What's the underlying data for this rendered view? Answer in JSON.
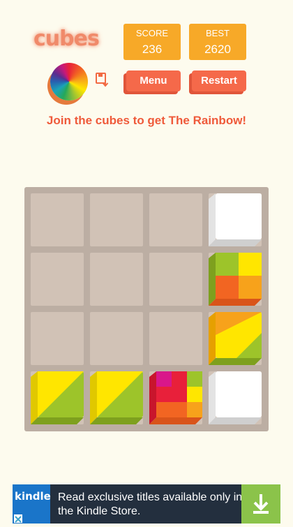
{
  "app": {
    "logo_text": "cubes"
  },
  "score": {
    "label": "SCORE",
    "value": "236"
  },
  "best": {
    "label": "BEST",
    "value": "2620"
  },
  "buttons": {
    "menu": "Menu",
    "restart": "Restart"
  },
  "tagline": "Join the cubes to get The Rainbow!",
  "board": {
    "size": 4,
    "tiles": [
      {
        "row": 0,
        "col": 3,
        "kind": "white"
      },
      {
        "row": 1,
        "col": 3,
        "kind": "green-yellow-orange-quad"
      },
      {
        "row": 2,
        "col": 3,
        "kind": "orange-yellow-green-diagonal"
      },
      {
        "row": 3,
        "col": 0,
        "kind": "yellow-green-diagonal"
      },
      {
        "row": 3,
        "col": 1,
        "kind": "yellow-green-diagonal"
      },
      {
        "row": 3,
        "col": 2,
        "kind": "magenta-green-red-yellow-quad"
      },
      {
        "row": 3,
        "col": 3,
        "kind": "white"
      }
    ]
  },
  "ad": {
    "logo_text": "kindle",
    "text": "Read exclusive titles available only in the Kindle Store.",
    "icons": [
      "download-icon",
      "ad-choices-icon",
      "color-wheel-icon",
      "save-icon"
    ]
  },
  "colors": {
    "background": "#fdfbee",
    "score_box": "#f7a928",
    "button": "#f5694a",
    "tagline": "#ef5a3a",
    "board": "#bcaea3",
    "cell": "#d1c2b6"
  }
}
